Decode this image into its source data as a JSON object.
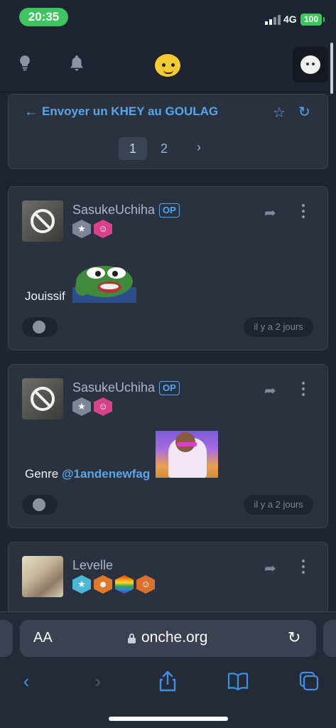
{
  "status_bar": {
    "time": "20:35",
    "network": "4G",
    "battery": "100"
  },
  "nav": {
    "icons": [
      "lightbulb-icon",
      "bell-icon",
      "site-logo",
      "user-avatar"
    ]
  },
  "topic": {
    "title": "Envoyer un KHEY au GOULAG",
    "pages": [
      "1",
      "2"
    ],
    "current_page": "1",
    "next_label": "›"
  },
  "posts": [
    {
      "username": "SasukeUchiha",
      "op_label": "OP",
      "text": "Jouissif",
      "mention": "",
      "timestamp": "il y a 2 jours"
    },
    {
      "username": "SasukeUchiha",
      "op_label": "OP",
      "text": "Genre ",
      "mention": "@1andenewfag",
      "timestamp": "il y a 2 jours"
    },
    {
      "username": "Levelle",
      "op_label": "",
      "text": "",
      "mention": "",
      "timestamp": ""
    }
  ],
  "browser": {
    "text_size_label": "AA",
    "url": "onche.org"
  },
  "colors": {
    "accent": "#58a6ea",
    "background": "#1e2532",
    "card": "#2a3240",
    "time_pill": "#3ec560"
  }
}
